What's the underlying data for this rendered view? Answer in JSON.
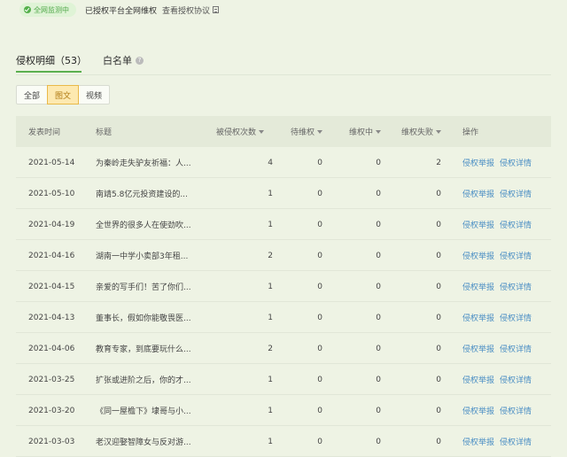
{
  "topbar": {
    "monitor_badge": "全网监测中",
    "authorized_text": "已授权平台全网维权",
    "agreement_link": "查看授权协议"
  },
  "tabs": [
    {
      "label": "侵权明细（53）",
      "active": true
    },
    {
      "label": "白名单",
      "active": false
    }
  ],
  "filters": [
    {
      "label": "全部",
      "active": false
    },
    {
      "label": "图文",
      "active": true
    },
    {
      "label": "视频",
      "active": false
    }
  ],
  "table": {
    "headers": {
      "date": "发表时间",
      "title": "标题",
      "times": "被侵权次数",
      "pending": "待维权",
      "doing": "维权中",
      "fail": "维权失败",
      "op": "操作"
    },
    "rows": [
      {
        "date": "2021-05-14",
        "title": "为秦岭走失驴友祈福：人...",
        "times": "4",
        "pending": "0",
        "doing": "0",
        "fail": "2"
      },
      {
        "date": "2021-05-10",
        "title": "南靖5.8亿元投资建设的...",
        "times": "1",
        "pending": "0",
        "doing": "0",
        "fail": "0"
      },
      {
        "date": "2021-04-19",
        "title": "全世界的很多人在使劲吹...",
        "times": "1",
        "pending": "0",
        "doing": "0",
        "fail": "0"
      },
      {
        "date": "2021-04-16",
        "title": "湖南一中学小卖部3年租...",
        "times": "2",
        "pending": "0",
        "doing": "0",
        "fail": "0"
      },
      {
        "date": "2021-04-15",
        "title": "亲爱的写手们！苦了你们...",
        "times": "1",
        "pending": "0",
        "doing": "0",
        "fail": "0"
      },
      {
        "date": "2021-04-13",
        "title": "董事长，假如你能敬畏医...",
        "times": "1",
        "pending": "0",
        "doing": "0",
        "fail": "0"
      },
      {
        "date": "2021-04-06",
        "title": "教育专家，到底要玩什么...",
        "times": "2",
        "pending": "0",
        "doing": "0",
        "fail": "0"
      },
      {
        "date": "2021-03-25",
        "title": "扩张或进阶之后，你的才...",
        "times": "1",
        "pending": "0",
        "doing": "0",
        "fail": "0"
      },
      {
        "date": "2021-03-20",
        "title": "《同一屋檐下》埭哥与小...",
        "times": "1",
        "pending": "0",
        "doing": "0",
        "fail": "0"
      },
      {
        "date": "2021-03-03",
        "title": "老汉迎娶智障女与反对游...",
        "times": "1",
        "pending": "0",
        "doing": "0",
        "fail": "0"
      }
    ],
    "op_report": "侵权举报",
    "op_detail": "侵权详情"
  }
}
